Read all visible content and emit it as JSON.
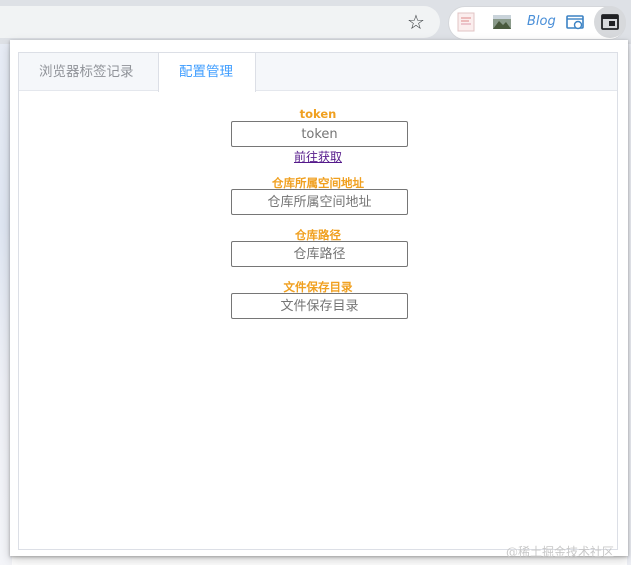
{
  "browser": {
    "bookmark_icon": "star-icon",
    "extensions": [
      {
        "name": "thumbnail-extension-icon"
      },
      {
        "name": "landscape-image-extension-icon"
      },
      {
        "name": "blog-extension-icon",
        "label": "Blog"
      },
      {
        "name": "sync-extension-icon"
      },
      {
        "name": "tab-manager-extension-icon"
      }
    ]
  },
  "popup": {
    "tabs": [
      {
        "label": "浏览器标签记录",
        "active": false
      },
      {
        "label": "配置管理",
        "active": true
      }
    ],
    "form": {
      "token": {
        "label": "token",
        "placeholder": "token",
        "link": "前往获取"
      },
      "namespace": {
        "label": "仓库所属空间地址",
        "placeholder": "仓库所属空间地址"
      },
      "repo_path": {
        "label": "仓库路径",
        "placeholder": "仓库路径"
      },
      "save_dir": {
        "label": "文件保存目录",
        "placeholder": "文件保存目录"
      }
    }
  },
  "watermark": "@稀土掘金技术社区",
  "colors": {
    "accent": "#409eff",
    "label": "#f0a020",
    "link": "#551a8b"
  }
}
